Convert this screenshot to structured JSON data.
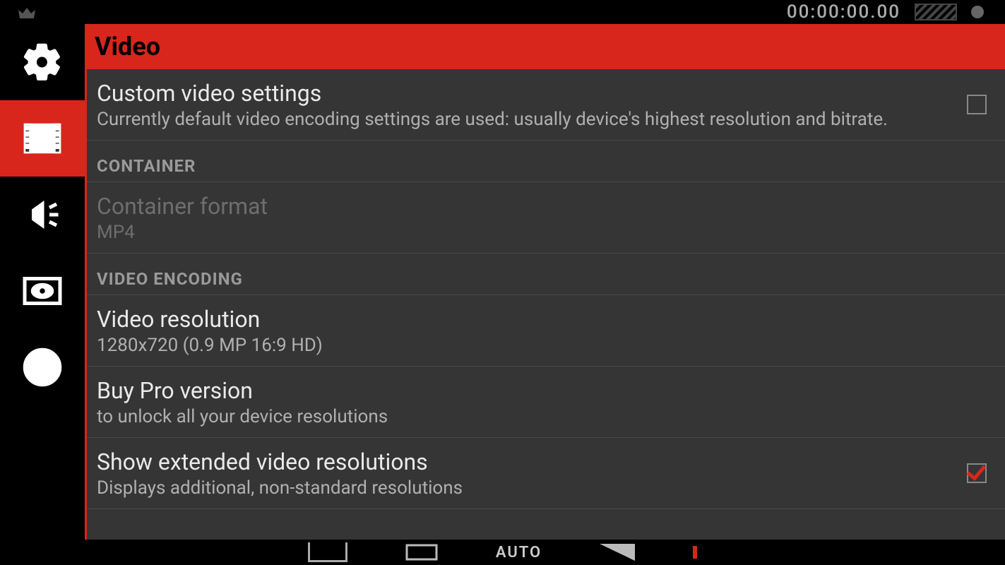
{
  "statusbar": {
    "time": "00:00:00.00"
  },
  "header": {
    "title": "Video"
  },
  "settings": {
    "custom_video": {
      "title": "Custom video settings",
      "sub": "Currently default video encoding settings are used: usually device's highest resolution and bitrate.",
      "checked": false
    },
    "section_container": "CONTAINER",
    "container_format": {
      "title": "Container format",
      "sub": "MP4"
    },
    "section_encoding": "VIDEO ENCODING",
    "video_resolution": {
      "title": "Video resolution",
      "sub": "1280x720 (0.9 MP 16:9 HD)"
    },
    "buy_pro": {
      "title": "Buy Pro version",
      "sub": "to unlock all your device resolutions"
    },
    "extended_res": {
      "title": "Show extended video resolutions",
      "sub": "Displays additional, non-standard resolutions",
      "checked": true
    }
  },
  "bottom": {
    "auto": "AUTO"
  }
}
